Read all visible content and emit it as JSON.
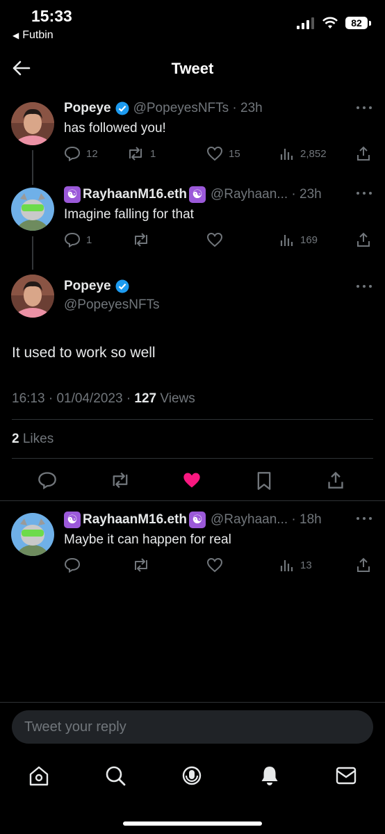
{
  "status_bar": {
    "time": "15:33",
    "back_app": "Futbin",
    "battery": "82"
  },
  "header": {
    "title": "Tweet"
  },
  "thread": [
    {
      "name": "Popeye",
      "handle": "@PopeyesNFTs",
      "age": "23h",
      "text": "has followed you!",
      "replies": "12",
      "retweets": "1",
      "likes": "15",
      "views": "2,852"
    },
    {
      "name": "RayhaanM16.eth",
      "handle": "@Rayhaan...",
      "age": "23h",
      "text": "Imagine falling for that",
      "replies": "1",
      "retweets": "",
      "likes": "",
      "views": "169"
    }
  ],
  "main_tweet": {
    "name": "Popeye",
    "handle": "@PopeyesNFTs",
    "text": "It used to work so well",
    "time": "16:13",
    "date": "01/04/2023",
    "views_count": "127",
    "views_label": "Views",
    "likes_count": "2",
    "likes_label": "Likes"
  },
  "reply": {
    "name": "RayhaanM16.eth",
    "handle": "@Rayhaan...",
    "age": "18h",
    "text": "Maybe it can happen for real",
    "replies": "",
    "retweets": "",
    "likes": "",
    "views": "13"
  },
  "compose": {
    "placeholder": "Tweet your reply"
  },
  "icons": {
    "reply": "reply-icon",
    "retweet": "retweet-icon",
    "like": "heart-icon",
    "views": "views-icon",
    "share": "share-icon",
    "bookmark": "bookmark-icon",
    "verified": "verified-badge-icon"
  },
  "colors": {
    "background": "#000000",
    "accent": "#1d9bf0",
    "like_active": "#f91880",
    "muted": "#71767b"
  }
}
